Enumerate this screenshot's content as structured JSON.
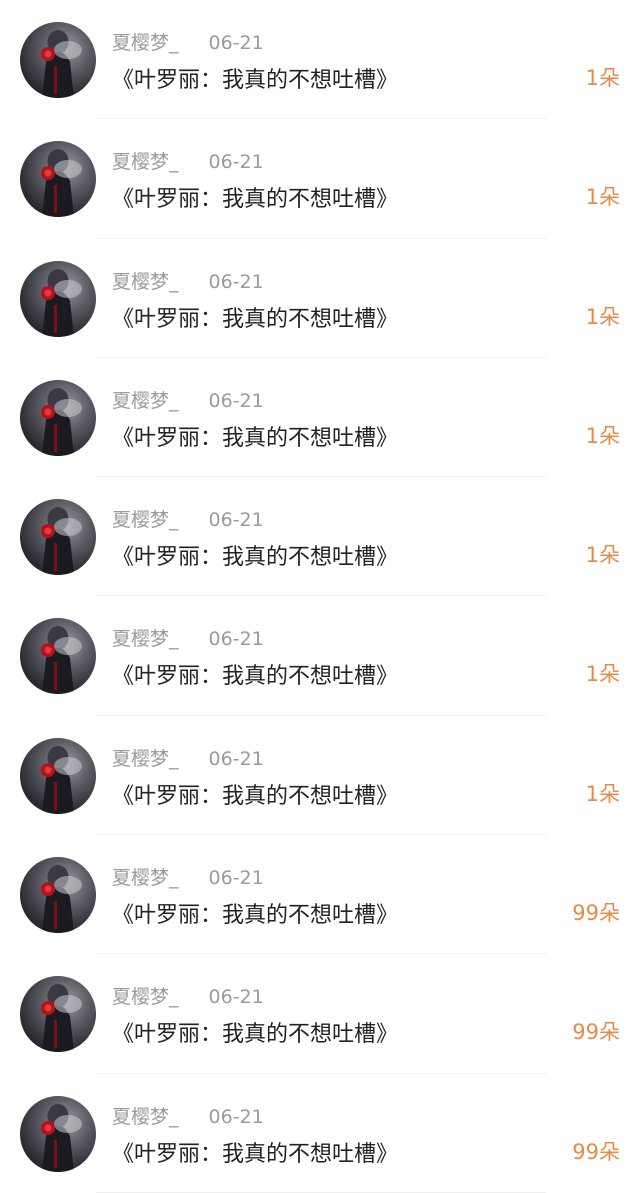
{
  "accent_color": "#e8894a",
  "items": [
    {
      "username": "夏樱梦_",
      "date": "06-21",
      "title": "《叶罗丽：我真的不想吐槽》",
      "count": "1朵"
    },
    {
      "username": "夏樱梦_",
      "date": "06-21",
      "title": "《叶罗丽：我真的不想吐槽》",
      "count": "1朵"
    },
    {
      "username": "夏樱梦_",
      "date": "06-21",
      "title": "《叶罗丽：我真的不想吐槽》",
      "count": "1朵"
    },
    {
      "username": "夏樱梦_",
      "date": "06-21",
      "title": "《叶罗丽：我真的不想吐槽》",
      "count": "1朵"
    },
    {
      "username": "夏樱梦_",
      "date": "06-21",
      "title": "《叶罗丽：我真的不想吐槽》",
      "count": "1朵"
    },
    {
      "username": "夏樱梦_",
      "date": "06-21",
      "title": "《叶罗丽：我真的不想吐槽》",
      "count": "1朵"
    },
    {
      "username": "夏樱梦_",
      "date": "06-21",
      "title": "《叶罗丽：我真的不想吐槽》",
      "count": "1朵"
    },
    {
      "username": "夏樱梦_",
      "date": "06-21",
      "title": "《叶罗丽：我真的不想吐槽》",
      "count": "99朵"
    },
    {
      "username": "夏樱梦_",
      "date": "06-21",
      "title": "《叶罗丽：我真的不想吐槽》",
      "count": "99朵"
    },
    {
      "username": "夏樱梦_",
      "date": "06-21",
      "title": "《叶罗丽：我真的不想吐槽》",
      "count": "99朵"
    }
  ]
}
